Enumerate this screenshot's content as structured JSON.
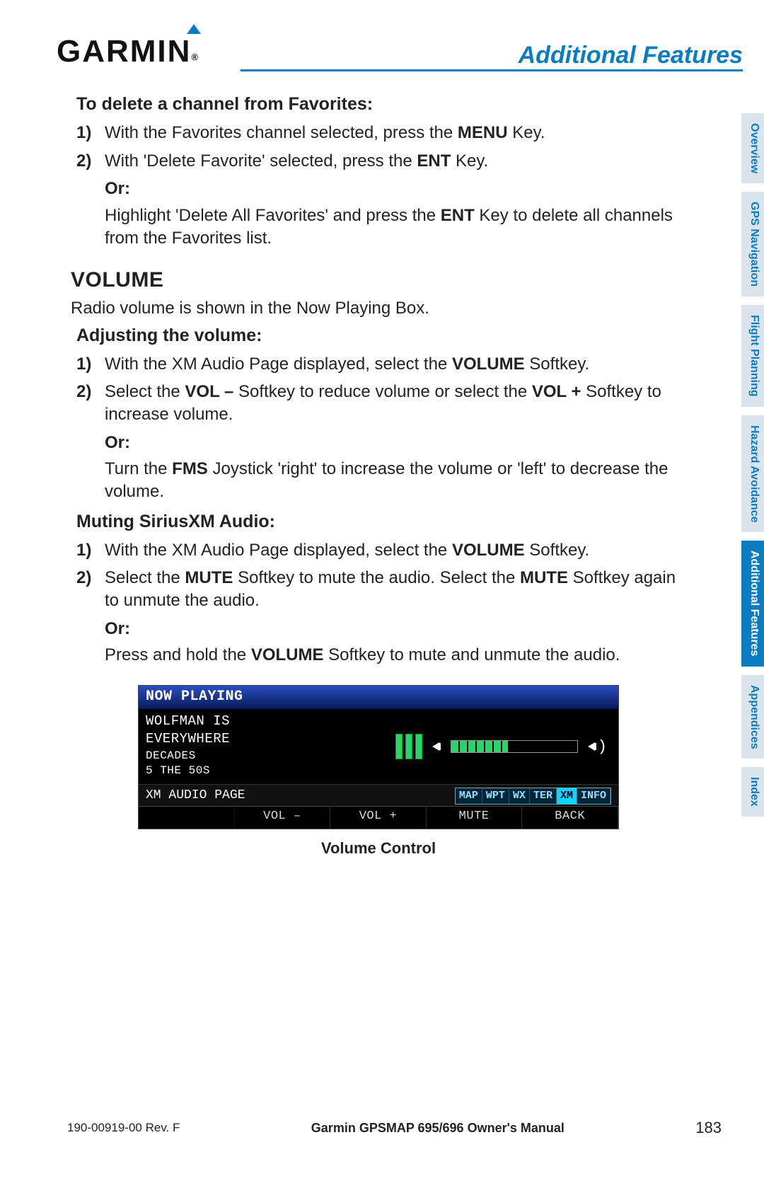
{
  "header": {
    "brand": "GARMIN",
    "page_title": "Additional Features"
  },
  "side_tabs": [
    {
      "label": "Overview",
      "active": false
    },
    {
      "label": "GPS Navigation",
      "active": false
    },
    {
      "label": "Flight Planning",
      "active": false
    },
    {
      "label": "Hazard Avoidance",
      "active": false
    },
    {
      "label": "Additional Features",
      "active": true
    },
    {
      "label": "Appendices",
      "active": false
    },
    {
      "label": "Index",
      "active": false
    }
  ],
  "sections": {
    "delete_fav": {
      "title": "To delete a channel from Favorites:",
      "step1_pre": "With the Favorites channel selected, press the ",
      "step1_b": "MENU",
      "step1_post": " Key.",
      "step2_pre": "With 'Delete Favorite' selected, press the ",
      "step2_b": "ENT",
      "step2_post": " Key.",
      "or": "Or:",
      "alt_pre": "Highlight 'Delete All Favorites' and press the ",
      "alt_b": "ENT",
      "alt_post": " Key to delete all channels from the Favorites list."
    },
    "volume": {
      "h2": "VOLUME",
      "intro": "Radio volume is shown in the Now Playing Box."
    },
    "adjust": {
      "title": "Adjusting the volume:",
      "s1_pre": "With the XM Audio Page displayed, select the ",
      "s1_b": "VOLUME",
      "s1_post": " Softkey.",
      "s2_pre": "Select the ",
      "s2_b1": "VOL –",
      "s2_mid": " Softkey to reduce volume or select the ",
      "s2_b2": "VOL +",
      "s2_post": " Softkey to increase volume.",
      "or": "Or:",
      "alt_pre": "Turn the ",
      "alt_b": "FMS",
      "alt_post": " Joystick 'right' to increase the volume or 'left' to decrease the volume."
    },
    "mute": {
      "title": "Muting SiriusXM Audio:",
      "s1_pre": "With the XM Audio Page displayed, select the ",
      "s1_b": "VOLUME",
      "s1_post": " Softkey.",
      "s2_pre": "Select the ",
      "s2_b1": "MUTE",
      "s2_mid": " Softkey to mute the audio.  Select the ",
      "s2_b2": "MUTE",
      "s2_post": " Softkey again to unmute the audio.",
      "or": "Or:",
      "alt_pre": "Press and hold the ",
      "alt_b": "VOLUME",
      "alt_post": " Softkey to mute and unmute the audio."
    }
  },
  "device": {
    "now_playing": "NOW PLAYING",
    "line1": "WOLFMAN IS",
    "line2": "EVERYWHERE",
    "line3": "DECADES",
    "line4": "5 THE 50S",
    "page_label": "XM AUDIO PAGE",
    "tabs": [
      "MAP",
      "WPT",
      "WX",
      "TER",
      "XM",
      "INFO"
    ],
    "active_tab": "XM",
    "softkeys": [
      "",
      "VOL –",
      "VOL +",
      "MUTE",
      "BACK"
    ],
    "caption": "Volume Control"
  },
  "footer": {
    "doc_id": "190-00919-00  Rev. F",
    "manual": "Garmin GPSMAP 695/696 Owner's Manual",
    "page": "183"
  }
}
